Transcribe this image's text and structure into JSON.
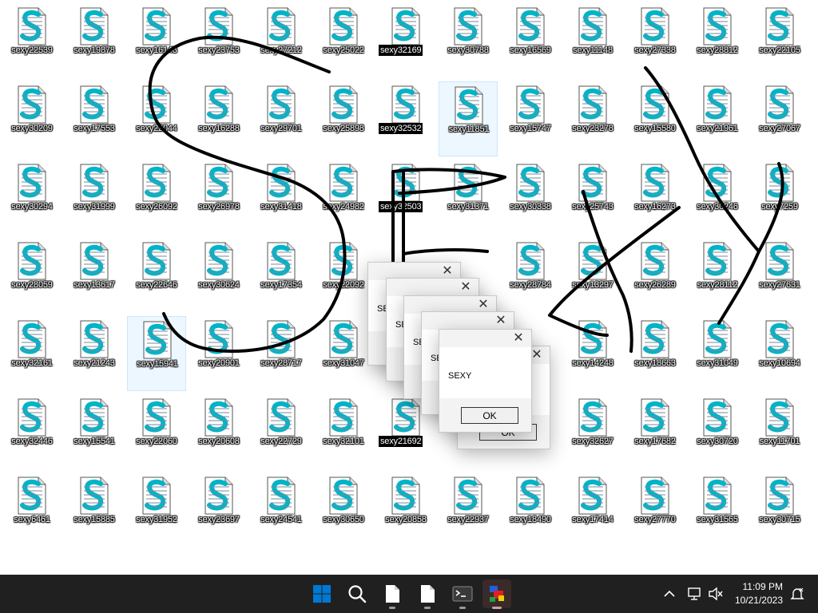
{
  "desktop": {
    "rows": [
      [
        "sexy22539",
        "sexy19878",
        "sexy16148",
        "sexy23753",
        "sexy27212",
        "sexy25022",
        "sexy32169",
        "sexy30788",
        "sexy16569",
        "sexy11148",
        "sexy27338",
        "sexy28812",
        "sexy22105"
      ],
      [
        "sexy30209",
        "sexy17553",
        "sexy22044",
        "sexy16288",
        "sexy29701",
        "sexy25898",
        "sexy32532",
        "sexy11851",
        "sexy15747",
        "sexy23278",
        "sexy15580",
        "sexy21961",
        "sexy27067"
      ],
      [
        "sexy30294",
        "sexy31999",
        "sexy26092",
        "sexy26978",
        "sexy31418",
        "sexy24982",
        "sexy32503",
        "sexy31371",
        "sexy30338",
        "sexy25743",
        "sexy16273",
        "sexy30246",
        "sexy7259"
      ],
      [
        "sexy28059",
        "sexy13617",
        "sexy22646",
        "sexy30624",
        "sexy17354",
        "sexy22092",
        "",
        "",
        "sexy28784",
        "sexy13297",
        "sexy26289",
        "sexy28112",
        "sexy27631"
      ],
      [
        "sexy32161",
        "sexy21243",
        "sexy15941",
        "sexy20901",
        "sexy28717",
        "sexy31047",
        "",
        "",
        "",
        "sexy14248",
        "sexy18663",
        "sexy31049",
        "sexy10694"
      ],
      [
        "sexy32446",
        "sexy15541",
        "sexy22060",
        "sexy20608",
        "sexy22729",
        "sexy32101",
        "sexy21692",
        "",
        "",
        "sexy32627",
        "sexy17682",
        "sexy30720",
        "sexy11701"
      ],
      [
        "sexy6461",
        "sexy15885",
        "sexy31952",
        "sexy23697",
        "sexy24541",
        "sexy30650",
        "sexy20858",
        "sexy22937",
        "sexy18490",
        "sexy17414",
        "sexy27770",
        "sexy31565",
        "sexy30715"
      ]
    ],
    "selected": [
      "sexy32169",
      "sexy32532",
      "sexy32503",
      "sexy21692"
    ],
    "hovered": [
      "sexy11851",
      "sexy15941"
    ],
    "icon_name": "text-document-icon"
  },
  "dialogs": [
    {
      "message": "SEXY",
      "ok_label": "OK",
      "close_glyph": "✕"
    },
    {
      "message": "SEXY",
      "ok_label": "OK",
      "close_glyph": "✕"
    },
    {
      "message": "SEXY",
      "ok_label": "OK",
      "close_glyph": "✕"
    },
    {
      "message": "SEXY",
      "ok_label": "OK",
      "close_glyph": "✕"
    },
    {
      "message": "SEXY",
      "ok_label": "OK",
      "close_glyph": "✕"
    },
    {
      "message": "SEXY",
      "ok_label": "OK",
      "close_glyph": "✕"
    }
  ],
  "taskbar": {
    "apps": [
      {
        "name": "start-button",
        "icon": "windows-logo-icon"
      },
      {
        "name": "search-button",
        "icon": "search-icon"
      },
      {
        "name": "file-button-1",
        "icon": "file-icon"
      },
      {
        "name": "file-button-2",
        "icon": "file-icon"
      },
      {
        "name": "terminal-button",
        "icon": "terminal-icon"
      },
      {
        "name": "malware-app-button",
        "icon": "app-icon"
      }
    ],
    "time": "11:09 PM",
    "date": "10/21/2023",
    "tray_icons": [
      "chevron-up-icon",
      "network-icon",
      "volume-muted-icon",
      "notification-icon"
    ]
  },
  "colors": {
    "taskbar_bg": "#202020",
    "windows_blue": "#0078d4",
    "document_cyan": "#00b4c8"
  }
}
